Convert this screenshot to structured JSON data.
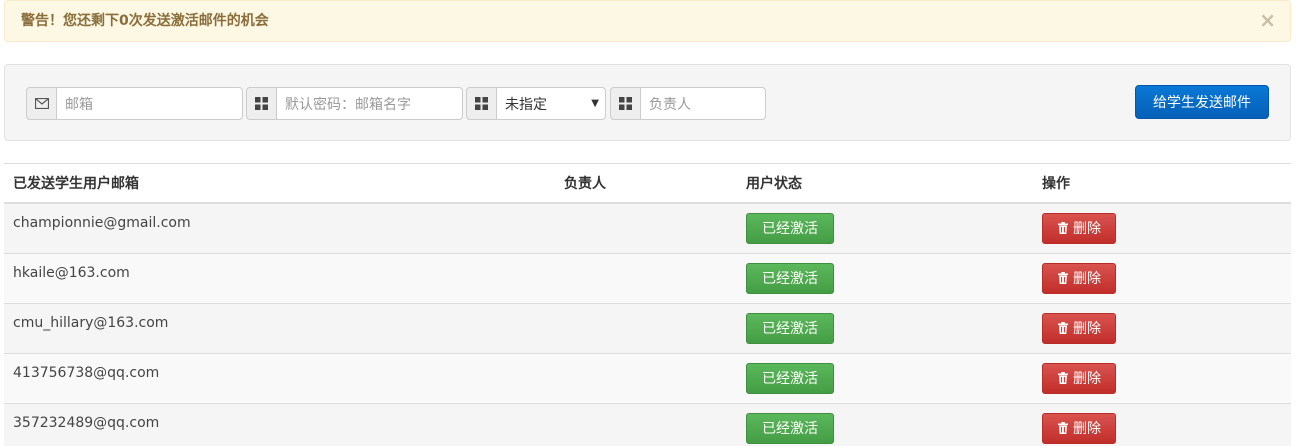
{
  "alert": {
    "text": "警告！您还剩下0次发送激活邮件的机会",
    "close": "×"
  },
  "filters": {
    "email_placeholder": "邮箱",
    "password_placeholder": "默认密码：邮箱名字",
    "select_value": "未指定",
    "owner_placeholder": "负责人",
    "send_button": "给学生发送邮件"
  },
  "table": {
    "headers": {
      "email": "已发送学生用户邮箱",
      "owner": "负责人",
      "status": "用户状态",
      "actions": "操作"
    },
    "rows": [
      {
        "email": "championnie@gmail.com",
        "owner": "",
        "status": "已经激活",
        "delete": "删除"
      },
      {
        "email": "hkaile@163.com",
        "owner": "",
        "status": "已经激活",
        "delete": "删除"
      },
      {
        "email": "cmu_hillary@163.com",
        "owner": "",
        "status": "已经激活",
        "delete": "删除"
      },
      {
        "email": "413756738@qq.com",
        "owner": "",
        "status": "已经激活",
        "delete": "删除"
      },
      {
        "email": "357232489@qq.com",
        "owner": "",
        "status": "已经激活",
        "delete": "删除"
      }
    ]
  },
  "colors": {
    "alert_bg": "#fcf8e3",
    "alert_text": "#8a6d3b",
    "primary": "#0a78d6",
    "success": "#5cb85c",
    "danger": "#d9534f"
  },
  "icons": {
    "email_addon": "envelope-icon",
    "grid_addon": "grid-icon",
    "delete": "trash-icon"
  }
}
